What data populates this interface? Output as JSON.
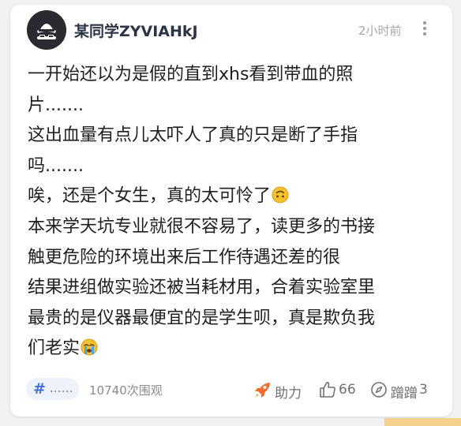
{
  "post": {
    "author": "某同学ZYVIAHkJ",
    "time": "2小时前",
    "lines": [
      "一开始还以为是假的直到xhs看到带血的照",
      "片.......",
      "这出血量有点儿太吓人了真的只是断了手指",
      "吗.......",
      "唉，还是个女生，真的太可怜了",
      "本来学天坑专业就很不容易了，读更多的书接",
      "触更危险的环境出来后工作待遇还差的很",
      "结果进组做实验还被当耗材用，合着实验室里",
      "最贵的是仪器最便宜的是学生呗，真是欺负我",
      "们老实"
    ]
  },
  "footer": {
    "hashtag": "......",
    "views": "10740次围观",
    "boost_label": "助力",
    "like_count": "66",
    "step_label": "蹭蹭",
    "step_count": "3"
  },
  "colors": {
    "hashtag_blue": "#4474cf",
    "boost_orange": "#f26d2e",
    "username": "#2b3347"
  }
}
